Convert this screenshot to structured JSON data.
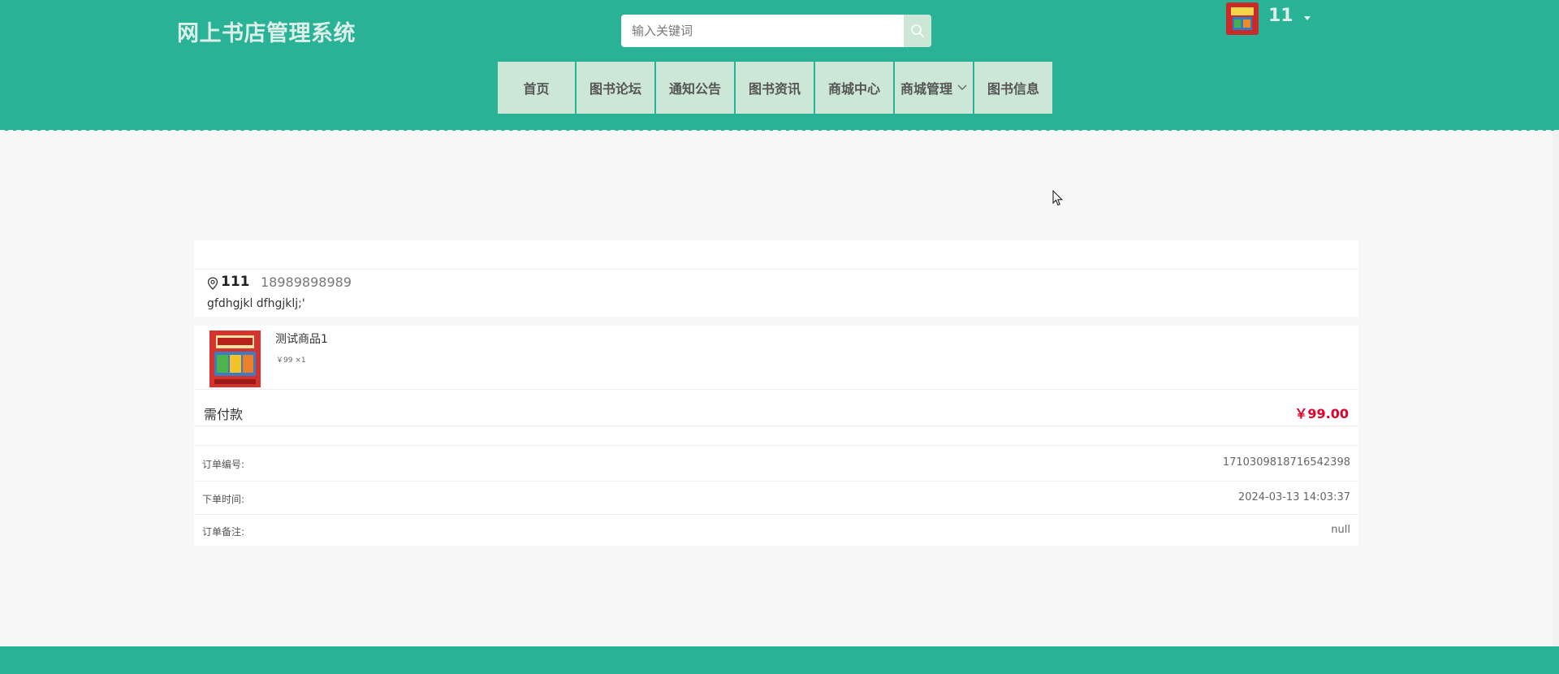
{
  "header": {
    "site_title": "网上书店管理系统",
    "search_placeholder": "输入关键词",
    "search_icon": "search-icon",
    "user_name": "11"
  },
  "nav": {
    "items": [
      {
        "label": "首页"
      },
      {
        "label": "图书论坛"
      },
      {
        "label": "通知公告"
      },
      {
        "label": "图书资讯"
      },
      {
        "label": "商城中心"
      },
      {
        "label": "商城管理",
        "has_dropdown": true
      },
      {
        "label": "图书信息"
      }
    ]
  },
  "order": {
    "address": {
      "name": "111",
      "phone": "18989898989",
      "detail": "gfdhgjkl dfhgjklj;'"
    },
    "goods": [
      {
        "name": "测试商品1",
        "price_qty": "￥99 ×1"
      }
    ],
    "pay_label": "需付款",
    "pay_value": "￥99.00",
    "info": [
      {
        "label": "订单编号:",
        "value": "1710309818716542398"
      },
      {
        "label": "下单时间:",
        "value": "2024-03-13 14:03:37"
      },
      {
        "label": "订单备注:",
        "value": "null"
      }
    ]
  },
  "colors": {
    "primary": "#29b296",
    "nav_bg": "#cde7d7",
    "price": "#e0002a"
  }
}
